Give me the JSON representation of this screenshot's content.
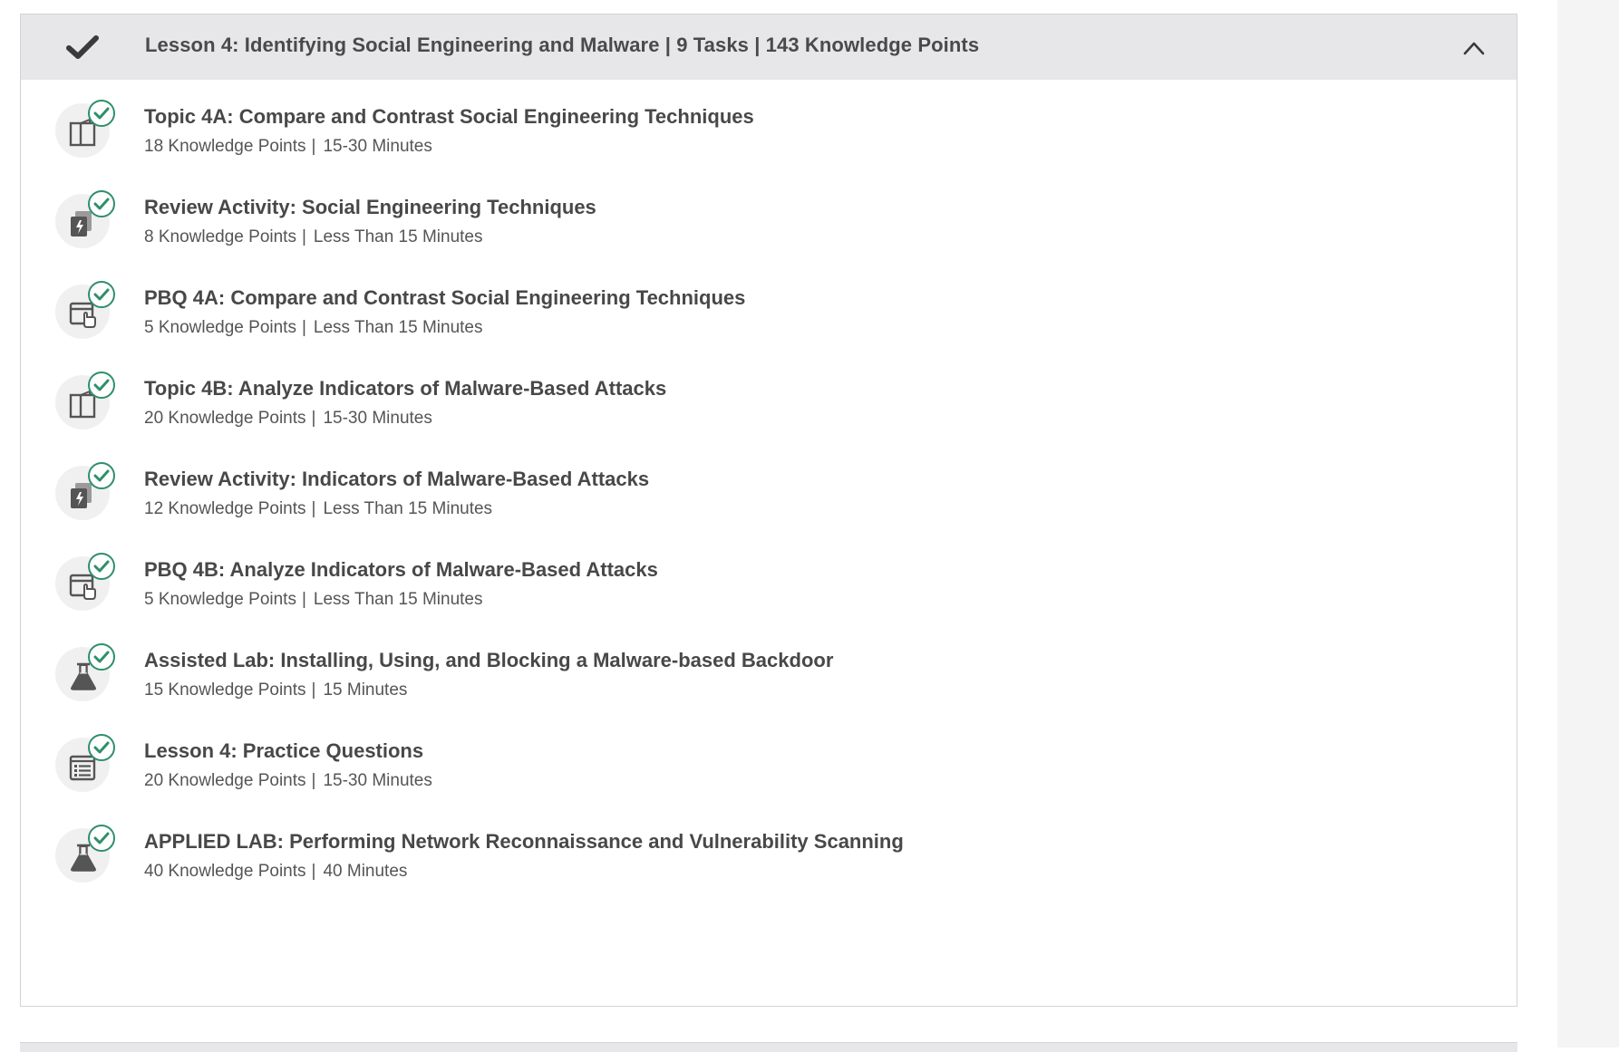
{
  "lesson": {
    "title": "Lesson 4: Identifying Social Engineering and Malware | 9 Tasks | 143 Knowledge Points",
    "status_icon": "checkmark-icon",
    "toggle_icon": "chevron-up-icon"
  },
  "colors": {
    "header_bg": "#e7e7ea",
    "badge_green": "#2f8f6a",
    "text": "#484848"
  },
  "items": [
    {
      "icon": "book-icon",
      "title": "Topic 4A: Compare and Contrast Social Engineering Techniques",
      "points": "18 Knowledge Points",
      "time": "15-30 Minutes",
      "completed": true
    },
    {
      "icon": "flashcards-icon",
      "title": "Review Activity: Social Engineering Techniques",
      "points": "8 Knowledge Points",
      "time": "Less Than 15 Minutes",
      "completed": true
    },
    {
      "icon": "pbq-icon",
      "title": "PBQ 4A: Compare and Contrast Social Engineering Techniques",
      "points": "5 Knowledge Points",
      "time": "Less Than 15 Minutes",
      "completed": true
    },
    {
      "icon": "book-icon",
      "title": "Topic 4B: Analyze Indicators of Malware-Based Attacks",
      "points": "20 Knowledge Points",
      "time": "15-30 Minutes",
      "completed": true
    },
    {
      "icon": "flashcards-icon",
      "title": "Review Activity: Indicators of Malware-Based Attacks",
      "points": "12 Knowledge Points",
      "time": "Less Than 15 Minutes",
      "completed": true
    },
    {
      "icon": "pbq-icon",
      "title": "PBQ 4B: Analyze Indicators of Malware-Based Attacks",
      "points": "5 Knowledge Points",
      "time": "Less Than 15 Minutes",
      "completed": true
    },
    {
      "icon": "flask-icon",
      "title": "Assisted Lab: Installing, Using, and Blocking a Malware-based Backdoor",
      "points": "15 Knowledge Points",
      "time": "15 Minutes",
      "completed": true
    },
    {
      "icon": "checklist-icon",
      "title": "Lesson 4: Practice Questions",
      "points": "20 Knowledge Points",
      "time": "15-30 Minutes",
      "completed": true
    },
    {
      "icon": "flask-icon",
      "title": "APPLIED LAB: Performing Network Reconnaissance and Vulnerability Scanning",
      "points": "40 Knowledge Points",
      "time": "40 Minutes",
      "completed": true
    }
  ]
}
